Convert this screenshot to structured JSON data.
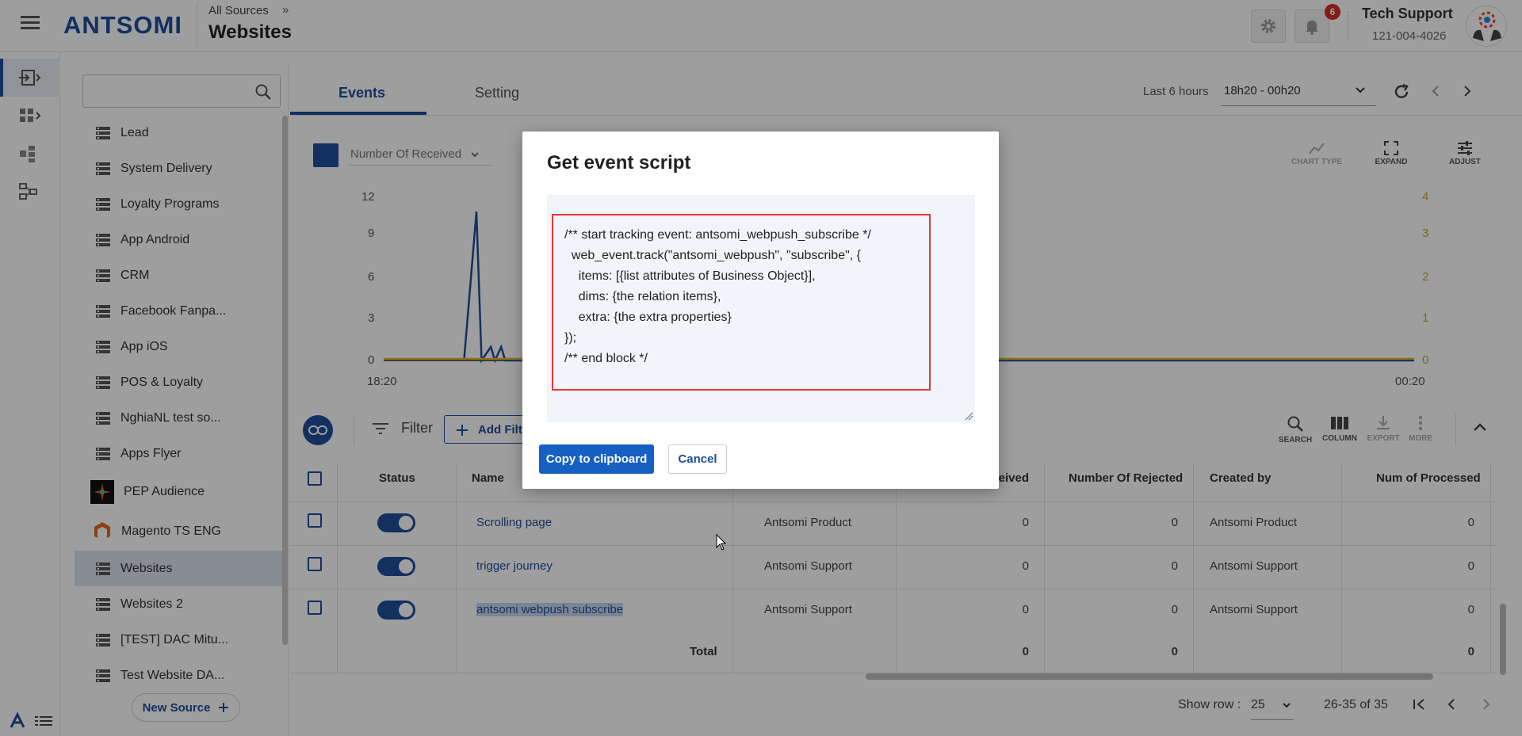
{
  "header": {
    "logo": "ANTSOMI",
    "breadcrumb": "All Sources",
    "breadcrumb_sep": "»",
    "page_title": "Websites",
    "notification_count": "6",
    "user_name": "Tech Support",
    "user_phone": "121-004-4026"
  },
  "sidebar": {
    "search_placeholder": "",
    "items": [
      {
        "label": "Lead",
        "icon": "database-icon"
      },
      {
        "label": "System Delivery",
        "icon": "database-icon"
      },
      {
        "label": "Loyalty Programs",
        "icon": "database-icon"
      },
      {
        "label": "App Android",
        "icon": "database-icon"
      },
      {
        "label": "CRM",
        "icon": "database-icon"
      },
      {
        "label": "Facebook Fanpa...",
        "icon": "database-icon"
      },
      {
        "label": "App iOS",
        "icon": "database-icon"
      },
      {
        "label": "POS & Loyalty",
        "icon": "database-icon"
      },
      {
        "label": "NghiaNL test so...",
        "icon": "database-icon"
      },
      {
        "label": "Apps Flyer",
        "icon": "database-icon"
      },
      {
        "label": "PEP Audience",
        "icon": "pep-logo-icon"
      },
      {
        "label": "Magento TS ENG",
        "icon": "magento-logo-icon"
      },
      {
        "label": "Websites",
        "icon": "database-icon"
      },
      {
        "label": "Websites 2",
        "icon": "database-icon"
      },
      {
        "label": "[TEST] DAC Mitu...",
        "icon": "database-icon"
      },
      {
        "label": "Test Website DA...",
        "icon": "database-icon"
      }
    ],
    "active_index": 12,
    "new_source_label": "New Source"
  },
  "tabs": [
    {
      "label": "Events",
      "active": true
    },
    {
      "label": "Setting",
      "active": false
    }
  ],
  "time_range": {
    "label": "Last 6 hours",
    "value": "18h20 - 00h20"
  },
  "chart": {
    "metric_label": "Number Of Received",
    "tools": [
      "CHART TYPE",
      "EXPAND",
      "ADJUST"
    ],
    "left_ticks": [
      "12",
      "9",
      "6",
      "3",
      "0"
    ],
    "right_ticks": [
      "4",
      "3",
      "2",
      "1",
      "0"
    ],
    "x_start": "18:20",
    "x_end": "00:20"
  },
  "chart_data": {
    "type": "line",
    "x_range": [
      "18:20",
      "00:20"
    ],
    "ylim_left": [
      0,
      12
    ],
    "ylim_right": [
      0,
      4
    ],
    "series": [
      {
        "name": "Number Of Received",
        "color": "#1e4e9c",
        "points": [
          [
            0.078,
            0
          ],
          [
            0.09,
            11
          ],
          [
            0.095,
            0
          ],
          [
            0.104,
            1
          ],
          [
            0.108,
            0
          ],
          [
            0.114,
            1
          ],
          [
            0.118,
            0
          ],
          [
            1.0,
            0
          ]
        ]
      },
      {
        "color": "#e8b622",
        "points": [
          [
            0,
            0
          ],
          [
            1,
            0
          ]
        ]
      }
    ]
  },
  "toolbar": {
    "filter_label": "Filter",
    "add_filter_label": "Add Filter",
    "tools": [
      "SEARCH",
      "COLUMN",
      "EXPORT",
      "MORE"
    ]
  },
  "table": {
    "headers": {
      "status": "Status",
      "name": "Name",
      "received": "Number Of Received",
      "rejected": "Number Of Rejected",
      "created_by": "Created by",
      "processed": "Num of Processed"
    },
    "rows": [
      {
        "name": "Scrolling page",
        "source": "Antsomi Product",
        "received": "0",
        "rejected": "0",
        "created_by": "Antsomi Product",
        "processed": "0"
      },
      {
        "name": "trigger journey",
        "source": "Antsomi Support",
        "received": "0",
        "rejected": "0",
        "created_by": "Antsomi Support",
        "processed": "0"
      },
      {
        "name": "antsomi webpush subscribe",
        "source": "Antsomi Support",
        "received": "0",
        "rejected": "0",
        "created_by": "Antsomi Support",
        "processed": "0"
      }
    ],
    "total_label": "Total",
    "total_received": "0",
    "total_rejected": "0",
    "total_processed": "0"
  },
  "pagination": {
    "show_row_label": "Show row :",
    "rows_per_page": "25",
    "range": "26-35 of 35"
  },
  "modal": {
    "title": "Get event script",
    "code_lines": [
      "/** start tracking event: antsomi_webpush_subscribe */",
      "  web_event.track(\"antsomi_webpush\", \"subscribe\", {",
      "    items: [{list attributes of Business Object}],",
      "    dims: {the relation items},",
      "    extra: {the extra properties}",
      "});",
      "/** end block */"
    ],
    "copy_label": "Copy to clipboard",
    "cancel_label": "Cancel"
  },
  "colors": {
    "brand": "#1e4e9c",
    "primary_button": "#1660c4",
    "highlight_border": "#e53935",
    "badge": "#d62b2b"
  }
}
